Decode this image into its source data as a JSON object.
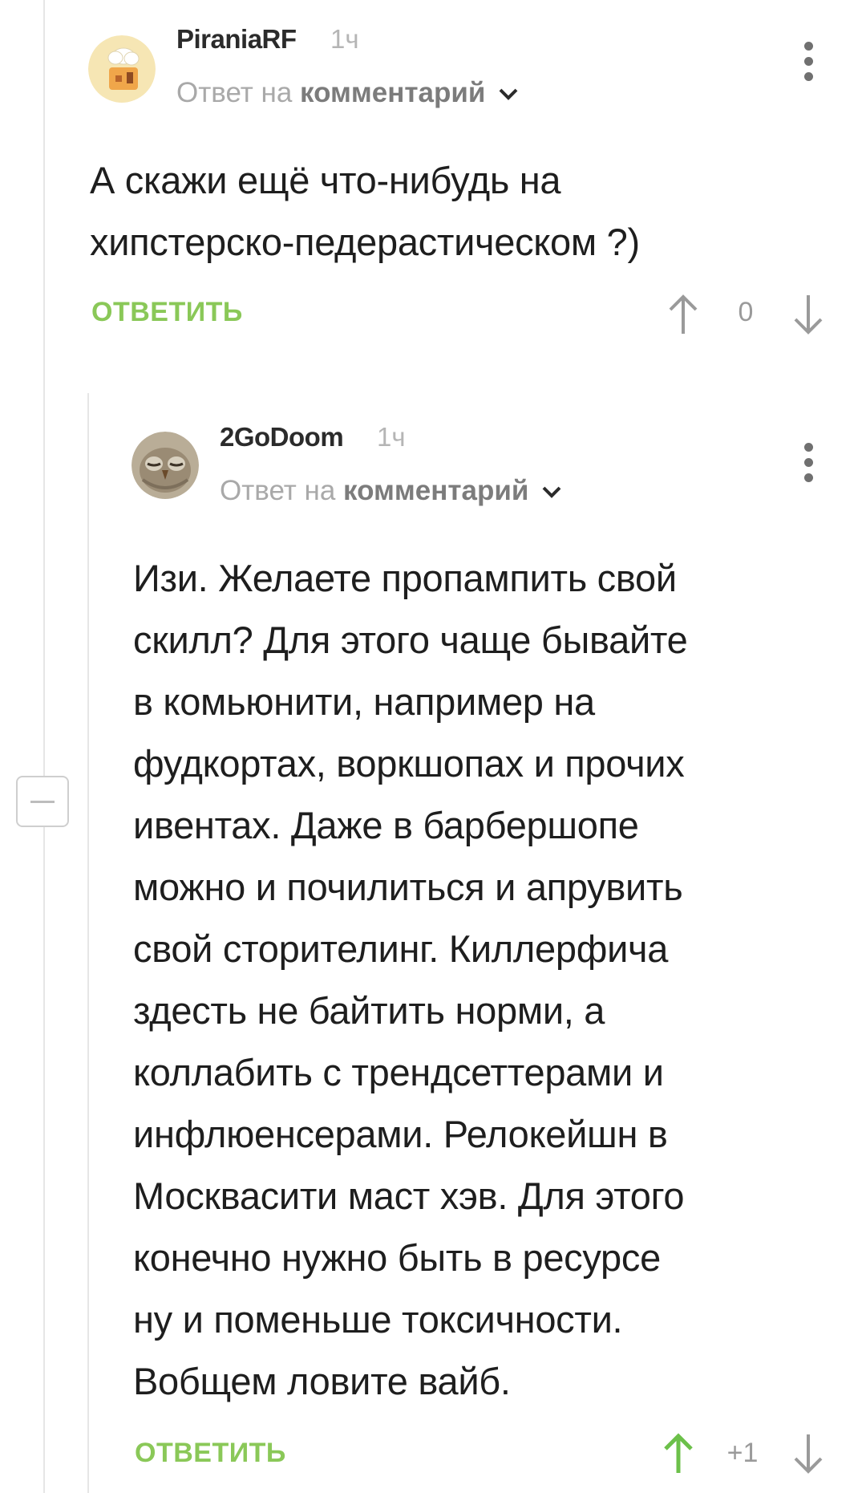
{
  "comments": [
    {
      "author": "PiraniaRF",
      "time": "1ч",
      "reply_prefix": "Ответ на",
      "reply_target": "комментарий",
      "text_lines": [
        "А скажи ещё что-нибудь на",
        "хипстерско-педерастическом ?)"
      ],
      "reply_label": "ОТВЕТИТЬ",
      "score": "0",
      "avatar_icon": "chef-house-avatar"
    },
    {
      "author": "2GoDoom",
      "time": "1ч",
      "reply_prefix": "Ответ на",
      "reply_target": "комментарий",
      "text_lines": [
        "Изи. Желаете пропампить свой",
        "скилл? Для этого чаще бывайте",
        "в комьюнити, например на",
        "фудкортах, воркшопах и прочих",
        "ивентах. Даже в барбершопе",
        "можно и почилиться и апрувить",
        "свой сторителинг. Киллерфича",
        "здесть не байтить норми, а",
        "коллабить с трендсеттерами и",
        "инфлюенсерами. Релокейшн в",
        "Москвасити маст хэв. Для этого",
        "конечно нужно быть в ресурсе",
        "ну и поменьше токсичности.",
        "Вобщем ловите вайб."
      ],
      "reply_label": "ОТВЕТИТЬ",
      "score": "+1",
      "avatar_icon": "owl-avatar"
    }
  ],
  "colors": {
    "accent_green": "#8ac858",
    "upvoted_green": "#6cc04a",
    "muted_gray": "#a9a9a9"
  }
}
